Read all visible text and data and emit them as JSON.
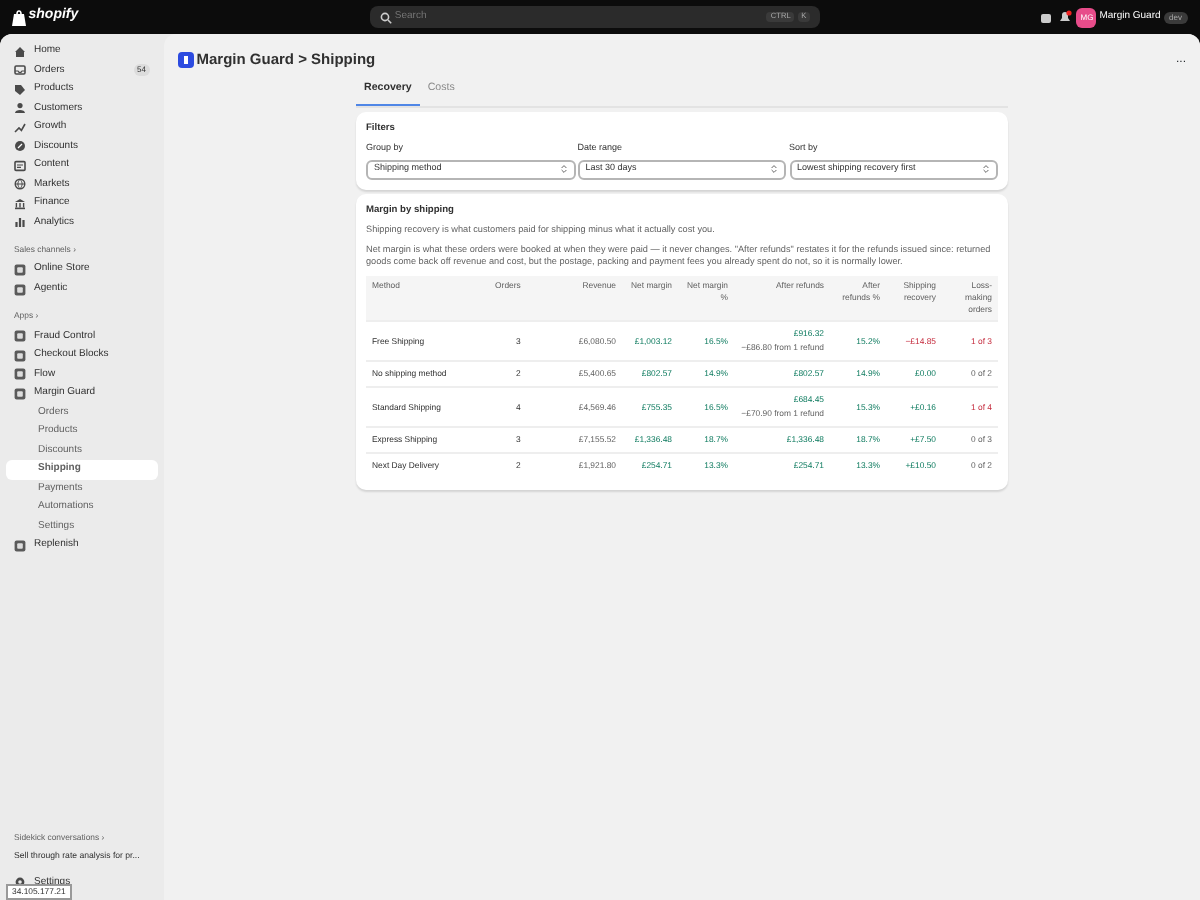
{
  "topbar": {
    "brand": "shopify",
    "search": {
      "placeholder": "Search",
      "keys": [
        "CTRL",
        "K"
      ]
    },
    "notifications": {
      "unread": true
    },
    "store": {
      "initials": "MG",
      "name": "Margin Guard",
      "badge": "dev"
    }
  },
  "sidebar": {
    "nav": [
      {
        "label": "Home",
        "selected": false
      },
      {
        "label": "Orders",
        "badge": "54",
        "selected": false
      },
      {
        "label": "Products",
        "selected": false
      },
      {
        "label": "Customers",
        "selected": false
      },
      {
        "label": "Growth",
        "selected": false
      },
      {
        "label": "Discounts",
        "selected": false
      },
      {
        "label": "Content",
        "selected": false
      },
      {
        "label": "Markets",
        "selected": false
      },
      {
        "label": "Finance",
        "selected": false
      },
      {
        "label": "Analytics",
        "selected": false
      }
    ],
    "sales_channels": {
      "heading": "Sales channels ›",
      "items": [
        {
          "label": "Online Store",
          "selected": false
        },
        {
          "label": "Agentic",
          "selected": false
        }
      ]
    },
    "apps": {
      "heading": "Apps ›",
      "items": [
        {
          "label": "Fraud Control",
          "selected": false
        },
        {
          "label": "Checkout Blocks",
          "selected": false
        },
        {
          "label": "Flow",
          "selected": false
        },
        {
          "label": "Margin Guard",
          "selected": false,
          "children": [
            {
              "label": "Orders",
              "selected": false
            },
            {
              "label": "Products",
              "selected": false
            },
            {
              "label": "Discounts",
              "selected": false
            },
            {
              "label": "Shipping",
              "selected": true
            },
            {
              "label": "Payments",
              "selected": false
            },
            {
              "label": "Automations",
              "selected": false
            },
            {
              "label": "Settings",
              "selected": false
            }
          ]
        },
        {
          "label": "Replenish",
          "selected": false
        }
      ]
    },
    "sidekick": {
      "heading": "Sidekick conversations ›",
      "items": [
        "Sell through rate analysis for pr..."
      ]
    },
    "settings": "Settings",
    "tooltip": "34.105.177.21"
  },
  "page": {
    "title": "Margin Guard > Shipping",
    "more": "...",
    "tabs": [
      {
        "label": "Recovery",
        "selected": true
      },
      {
        "label": "Costs",
        "selected": false
      }
    ],
    "filters": {
      "title": "Filters",
      "fields": [
        {
          "label": "Group by",
          "value": "Shipping method"
        },
        {
          "label": "Date range",
          "value": "Last 30 days"
        },
        {
          "label": "Sort by",
          "value": "Lowest shipping recovery first"
        }
      ]
    },
    "margin": {
      "title": "Margin by shipping",
      "paragraphs": [
        "Shipping recovery is what customers paid for shipping minus what it actually cost you.",
        "Net margin is what these orders were booked at when they were paid — it never changes. \"After refunds\" restates it for the refunds issued since: returned goods come back off revenue and cost, but the postage, packing and payment fees you already spent do not, so it is normally lower."
      ],
      "table": {
        "columns": [
          "Method",
          "Orders",
          "Revenue",
          "Net margin",
          "Net margin %",
          "After refunds",
          "After refunds %",
          "Shipping recovery",
          "Loss-making orders"
        ],
        "rows": [
          {
            "method": "Free Shipping",
            "orders": "3",
            "revenue": "£6,080.50",
            "net_margin": "£1,003.12",
            "net_margin_pct": "16.5%",
            "after_refunds": "£916.32",
            "after_refunds_note": "−£86.80 from 1 refund",
            "after_refunds_pct": "15.2%",
            "recovery": "−£14.85",
            "recovery_negative": true,
            "loss": "1 of 3",
            "loss_flagged": true
          },
          {
            "method": "No shipping method",
            "orders": "2",
            "revenue": "£5,400.65",
            "net_margin": "£802.57",
            "net_margin_pct": "14.9%",
            "after_refunds": "£802.57",
            "after_refunds_pct": "14.9%",
            "recovery": "£0.00",
            "recovery_negative": false,
            "loss": "0 of 2",
            "loss_flagged": false
          },
          {
            "method": "Standard Shipping",
            "orders": "4",
            "revenue": "£4,569.46",
            "net_margin": "£755.35",
            "net_margin_pct": "16.5%",
            "after_refunds": "£684.45",
            "after_refunds_note": "−£70.90 from 1 refund",
            "after_refunds_pct": "15.3%",
            "recovery": "+£0.16",
            "recovery_negative": false,
            "loss": "1 of 4",
            "loss_flagged": true
          },
          {
            "method": "Express Shipping",
            "orders": "3",
            "revenue": "£7,155.52",
            "net_margin": "£1,336.48",
            "net_margin_pct": "18.7%",
            "after_refunds": "£1,336.48",
            "after_refunds_pct": "18.7%",
            "recovery": "+£7.50",
            "recovery_negative": false,
            "loss": "0 of 3",
            "loss_flagged": false
          },
          {
            "method": "Next Day Delivery",
            "orders": "2",
            "revenue": "£1,921.80",
            "net_margin": "£254.71",
            "net_margin_pct": "13.3%",
            "after_refunds": "£254.71",
            "after_refunds_pct": "13.3%",
            "recovery": "+£10.50",
            "recovery_negative": false,
            "loss": "0 of 2",
            "loss_flagged": false
          }
        ]
      }
    }
  }
}
